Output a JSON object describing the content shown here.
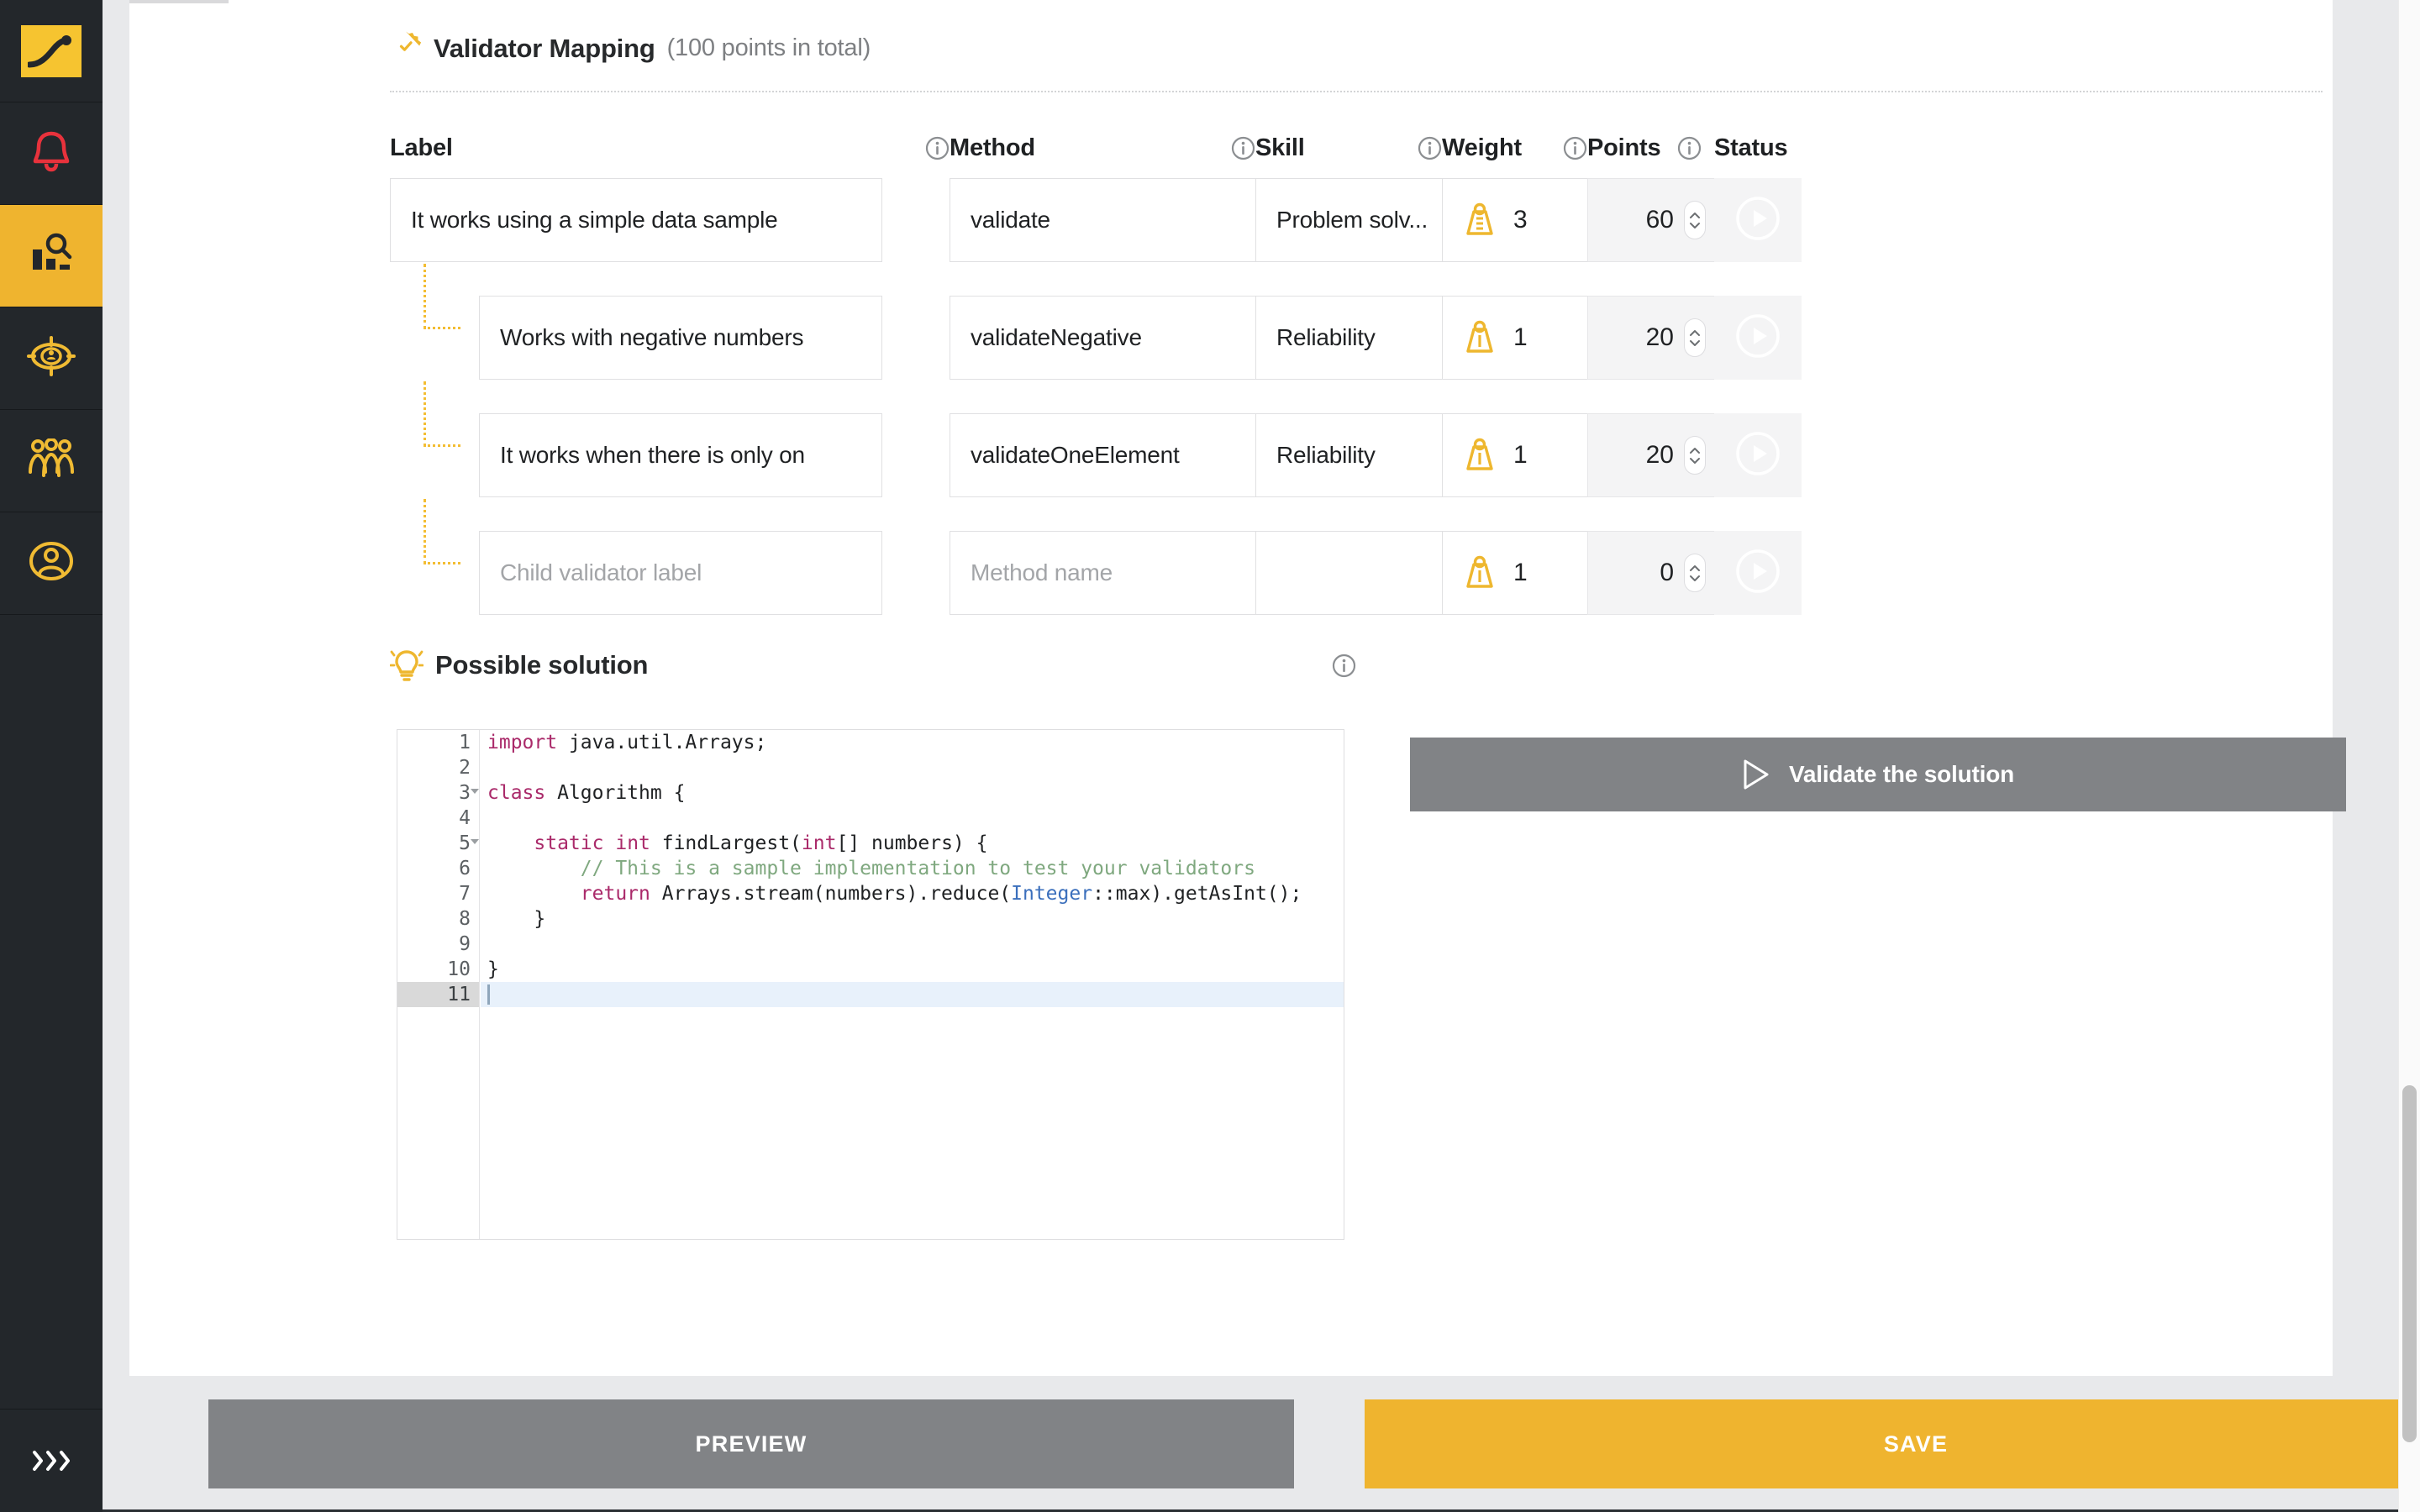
{
  "sidebar": {
    "items": [
      {
        "name": "logo",
        "icon": "brand-logo-icon",
        "active": false
      },
      {
        "name": "notifications",
        "icon": "bell-icon",
        "active": false
      },
      {
        "name": "assessments",
        "icon": "chart-search-icon",
        "active": true
      },
      {
        "name": "targets",
        "icon": "target-person-icon",
        "active": false
      },
      {
        "name": "teams",
        "icon": "people-group-icon",
        "active": false
      },
      {
        "name": "account",
        "icon": "user-circle-icon",
        "active": false
      }
    ],
    "expand_label": "›››",
    "expand_icon": "chevrons-right-icon",
    "accent": "#efb42f",
    "bg": "#23272b"
  },
  "section": {
    "icon": "gear-check-icon",
    "title": "Validator Mapping",
    "subtitle": "(100 points in total)"
  },
  "table": {
    "columns": [
      {
        "key": "label",
        "label": "Label",
        "info": true,
        "info_icon": "info-icon"
      },
      {
        "key": "method",
        "label": "Method",
        "info": true,
        "info_icon": "info-icon"
      },
      {
        "key": "skill",
        "label": "Skill",
        "info": true,
        "info_icon": "info-icon"
      },
      {
        "key": "weight",
        "label": "Weight",
        "info": true,
        "info_icon": "info-icon"
      },
      {
        "key": "points",
        "label": "Points",
        "info": true,
        "info_icon": "info-icon"
      },
      {
        "key": "status",
        "label": "Status",
        "info": false,
        "info_icon": ""
      }
    ],
    "placeholders": {
      "child_label": "Child validator label",
      "method_name": "Method name"
    },
    "rows": [
      {
        "child": false,
        "label": "It works using a simple data sample",
        "label_is_placeholder": false,
        "method": "validate",
        "method_is_placeholder": false,
        "skill": "Problem solv...",
        "weight": "3",
        "weight_icon": "weight-icon",
        "points": "60",
        "status_icon": "play-circle-icon"
      },
      {
        "child": true,
        "label": "Works with negative numbers",
        "label_is_placeholder": false,
        "method": "validateNegative",
        "method_is_placeholder": false,
        "skill": "Reliability",
        "weight": "1",
        "weight_icon": "weight-icon",
        "points": "20",
        "status_icon": "play-circle-icon"
      },
      {
        "child": true,
        "label": "It works when there is only on",
        "label_is_placeholder": false,
        "method": "validateOneElement",
        "method_is_placeholder": false,
        "skill": "Reliability",
        "weight": "1",
        "weight_icon": "weight-icon",
        "points": "20",
        "status_icon": "play-circle-icon"
      },
      {
        "child": true,
        "label": "Child validator label",
        "label_is_placeholder": true,
        "method": "Method name",
        "method_is_placeholder": true,
        "skill": "",
        "weight": "1",
        "weight_icon": "weight-icon",
        "points": "0",
        "status_icon": "play-circle-icon"
      }
    ]
  },
  "possible_solution": {
    "icon": "lightbulb-icon",
    "title": "Possible solution",
    "info_icon": "info-icon",
    "editor": {
      "language": "java",
      "active_line": 11,
      "total_lines": 11,
      "lines": [
        {
          "n": "1",
          "fold": false,
          "text": "import java.util.Arrays;"
        },
        {
          "n": "2",
          "fold": false,
          "text": ""
        },
        {
          "n": "3",
          "fold": true,
          "text": "class Algorithm {"
        },
        {
          "n": "4",
          "fold": false,
          "text": ""
        },
        {
          "n": "5",
          "fold": true,
          "text": "    static int findLargest(int[] numbers) {"
        },
        {
          "n": "6",
          "fold": false,
          "text": "        // This is a sample implementation to test your validators"
        },
        {
          "n": "7",
          "fold": false,
          "text": "        return Arrays.stream(numbers).reduce(Integer::max).getAsInt();"
        },
        {
          "n": "8",
          "fold": false,
          "text": "    }"
        },
        {
          "n": "9",
          "fold": false,
          "text": ""
        },
        {
          "n": "10",
          "fold": false,
          "text": "}"
        },
        {
          "n": "11",
          "fold": false,
          "text": ""
        }
      ]
    },
    "validate_button": {
      "label": "Validate the solution",
      "icon": "play-triangle-icon",
      "color": "#818386"
    }
  },
  "footer": {
    "preview_label": "PREVIEW",
    "save_label": "SAVE",
    "preview_color": "#818386",
    "save_color": "#efb42f"
  }
}
